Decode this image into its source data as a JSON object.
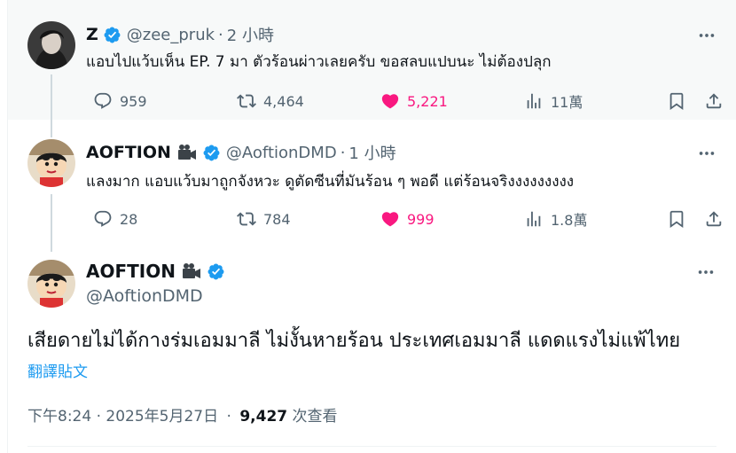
{
  "tweets": [
    {
      "name": "Z",
      "handle": "@zee_pruk",
      "time": "2 小時",
      "text": "แอบไปแว้บเห็น EP. 7 มา ตัวร้อนผ่าวเลยครับ ขอสลบแปบนะ ไม่ต้องปลุก",
      "replies": "959",
      "reposts": "4,464",
      "likes": "5,221",
      "views": "11萬"
    },
    {
      "name": "AOFTION",
      "handle": "@AoftionDMD",
      "time": "1 小時",
      "text": "แลงมาก แอบแว้บมาถูกจังหวะ ดูตัดซีนที่มันร้อน ๆ พอดี แต่ร้อนจริงงงงงงงงง",
      "replies": "28",
      "reposts": "784",
      "likes": "999",
      "views": "1.8萬"
    }
  ],
  "main": {
    "name": "AOFTION",
    "handle": "@AoftionDMD",
    "text": "เสียดายไม่ได้กางร่มเอมมาลี ไม่งั้นหายร้อน ประเทศเอมมาลี แดดแรงไม่แพ้ไทย",
    "translate": "翻譯貼文",
    "timestamp": "下午8:24 · 2025年5月27日",
    "dot": "·",
    "views_count": "9,427",
    "views_label": "次查看"
  },
  "ui": {
    "dot": "·",
    "more": "···"
  },
  "colors": {
    "accent": "#1d9bf0",
    "like": "#f91880",
    "muted": "#536471",
    "highlight_bg": "#f7f9f9"
  }
}
